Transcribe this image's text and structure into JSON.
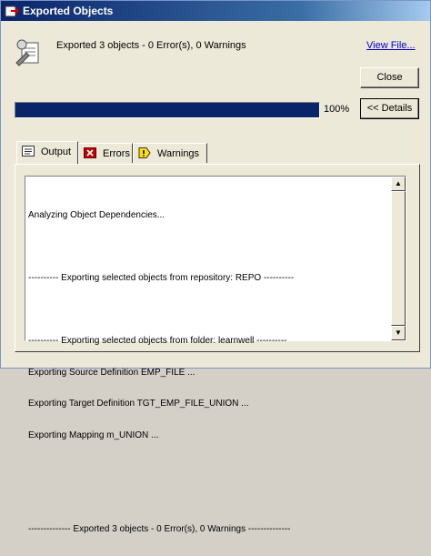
{
  "window": {
    "title": "Exported Objects",
    "icon": "export-objects-icon"
  },
  "summary": {
    "icon": "export-document-icon",
    "message": "Exported 3 objects - 0 Error(s), 0 Warnings",
    "view_file_label": "View File..."
  },
  "buttons": {
    "close_label": "Close",
    "details_label": "<< Details"
  },
  "progress": {
    "value_percent": 100,
    "label": "100%"
  },
  "tabs": [
    {
      "label": "Output",
      "icon": "output-icon",
      "active": true
    },
    {
      "label": "Errors",
      "icon": "error-icon",
      "active": false
    },
    {
      "label": "Warnings",
      "icon": "warning-icon",
      "active": false
    }
  ],
  "output_log": {
    "lines": [
      "Analyzing Object Dependencies...",
      "",
      "---------- Exporting selected objects from repository: REPO ----------",
      "",
      "---------- Exporting selected objects from folder: learnwell ----------",
      "Exporting Source Definition EMP_FILE ...",
      "Exporting Target Definition TGT_EMP_FILE_UNION ...",
      "Exporting Mapping m_UNION ...",
      "",
      "",
      "-------------- Exported 3 objects - 0 Error(s), 0 Warnings --------------"
    ]
  },
  "colors": {
    "progress_fill": "#0a246a",
    "link": "#0000cc"
  }
}
